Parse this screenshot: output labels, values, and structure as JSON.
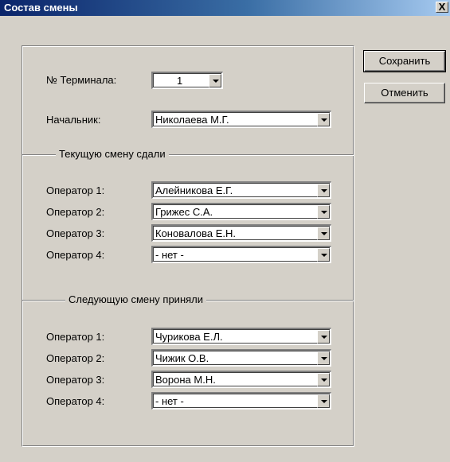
{
  "window": {
    "title": "Состав смены",
    "close_label": "X"
  },
  "terminal": {
    "label": "№ Терминала:",
    "value": "1"
  },
  "chief": {
    "label": "Начальник:",
    "value": "Николаева М.Г."
  },
  "handed_over": {
    "title": "Текущую смену сдали",
    "rows": [
      {
        "label": "Оператор 1:",
        "value": "Алейникова Е.Г."
      },
      {
        "label": "Оператор 2:",
        "value": "Грижес С.А."
      },
      {
        "label": "Оператор 3:",
        "value": "Коновалова Е.Н."
      },
      {
        "label": "Оператор 4:",
        "value": "- нет -"
      }
    ]
  },
  "taken_over": {
    "title": "Следующую смену приняли",
    "rows": [
      {
        "label": "Оператор 1:",
        "value": "Чурикова Е.Л."
      },
      {
        "label": "Оператор 2:",
        "value": "Чижик О.В."
      },
      {
        "label": "Оператор 3:",
        "value": "Ворона М.Н."
      },
      {
        "label": "Оператор 4:",
        "value": "- нет -"
      }
    ]
  },
  "buttons": {
    "save": "Сохранить",
    "cancel": "Отменить"
  },
  "icons": {
    "close": "close-icon",
    "dropdown": "chevron-down-icon"
  }
}
